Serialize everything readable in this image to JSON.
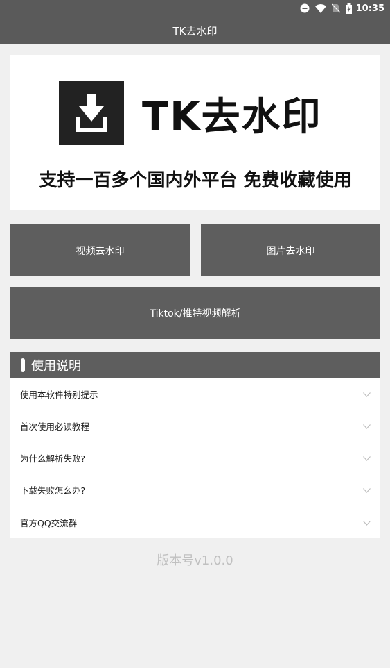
{
  "status_bar": {
    "time": "10:35",
    "icons": [
      "minus-circle-icon",
      "wifi-icon",
      "no-sim-icon",
      "battery-charging-icon"
    ]
  },
  "app_bar": {
    "title": "TK去水印"
  },
  "banner": {
    "logo_text": "TK去水印",
    "slogan": "支持一百多个国内外平台 免费收藏使用",
    "logo_icon": "download-icon"
  },
  "buttons": {
    "video": "视频去水印",
    "image": "图片去水印",
    "tiktok": "Tiktok/推特视频解析"
  },
  "section": {
    "title": "使用说明"
  },
  "help_items": [
    {
      "label": "使用本软件特别提示"
    },
    {
      "label": "首次使用必读教程"
    },
    {
      "label": "为什么解析失败?"
    },
    {
      "label": "下载失败怎么办?"
    },
    {
      "label": "官方QQ交流群"
    }
  ],
  "footer": {
    "version": "版本号v1.0.0"
  },
  "colors": {
    "bar_bg": "#5a5a5a",
    "button_bg": "#5e5e5e",
    "page_bg": "#f0f0f0"
  }
}
